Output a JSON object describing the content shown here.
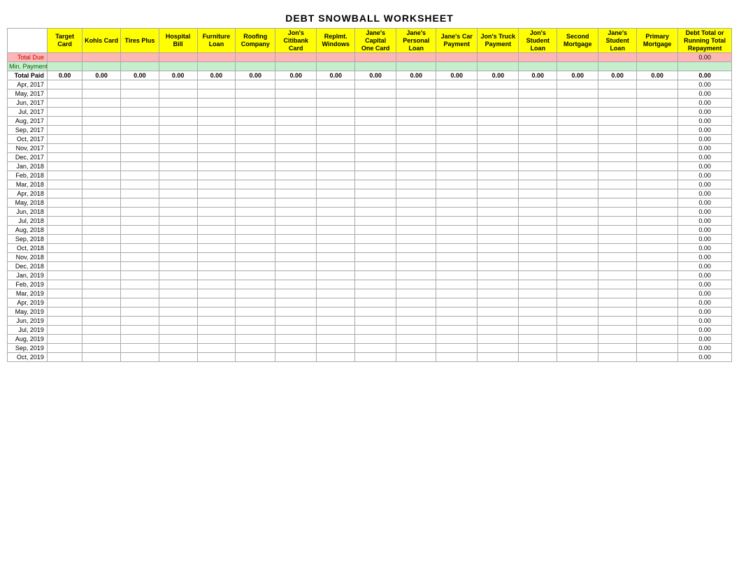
{
  "title": "DEBT SNOWBALL WORKSHEET",
  "columns": [
    {
      "id": "date",
      "label": "",
      "sub": "",
      "bg": "white"
    },
    {
      "id": "target",
      "label": "Target",
      "sub": "Card",
      "bg": "yellow"
    },
    {
      "id": "kohls",
      "label": "Kohls Card",
      "sub": "",
      "bg": "yellow"
    },
    {
      "id": "tires",
      "label": "Tires Plus",
      "sub": "",
      "bg": "yellow"
    },
    {
      "id": "hospital",
      "label": "Hospital",
      "sub": "Bill",
      "bg": "yellow"
    },
    {
      "id": "furniture",
      "label": "Furniture",
      "sub": "Loan",
      "bg": "yellow"
    },
    {
      "id": "roofing",
      "label": "Roofing",
      "sub": "Company",
      "bg": "yellow"
    },
    {
      "id": "jons_citibank",
      "label": "Jon's",
      "sub": "Citibank Card",
      "bg": "yellow"
    },
    {
      "id": "replmt_windows",
      "label": "Replmt.",
      "sub": "Windows",
      "bg": "yellow"
    },
    {
      "id": "janes_capital",
      "label": "Jane's",
      "sub": "Capital One Card",
      "bg": "yellow"
    },
    {
      "id": "janes_personal",
      "label": "Jane's",
      "sub": "Personal Loan",
      "bg": "yellow"
    },
    {
      "id": "janes_car",
      "label": "Jane's Car",
      "sub": "Payment",
      "bg": "yellow"
    },
    {
      "id": "jons_truck",
      "label": "Jon's Truck",
      "sub": "Payment",
      "bg": "yellow"
    },
    {
      "id": "jons_student",
      "label": "Jon's",
      "sub": "Student Loan",
      "bg": "yellow"
    },
    {
      "id": "second_mortgage",
      "label": "Second",
      "sub": "Mortgage",
      "bg": "yellow"
    },
    {
      "id": "janes_student",
      "label": "Jane's",
      "sub": "Student Loan",
      "bg": "yellow"
    },
    {
      "id": "primary_mortgage",
      "label": "Primary",
      "sub": "Mortgage",
      "bg": "yellow"
    },
    {
      "id": "debt_total",
      "label": "Debt Total or",
      "sub": "Running Total Repayment",
      "bg": "yellow"
    }
  ],
  "special_rows": {
    "total_due_label": "Total Due",
    "min_payment_label": "Min. Payment",
    "total_paid_label": "Total Paid"
  },
  "total_paid_values": [
    "0.00",
    "0.00",
    "0.00",
    "0.00",
    "0.00",
    "0.00",
    "0.00",
    "0.00",
    "0.00",
    "0.00",
    "0.00",
    "0.00",
    "0.00",
    "0.00",
    "0.00",
    "0.00",
    "0.00"
  ],
  "last_col_value": "0.00",
  "months": [
    "Apr, 2017",
    "May, 2017",
    "Jun, 2017",
    "Jul, 2017",
    "Aug, 2017",
    "Sep, 2017",
    "Oct, 2017",
    "Nov, 2017",
    "Dec, 2017",
    "Jan, 2018",
    "Feb, 2018",
    "Mar, 2018",
    "Apr, 2018",
    "May, 2018",
    "Jun, 2018",
    "Jul, 2018",
    "Aug, 2018",
    "Sep, 2018",
    "Oct, 2018",
    "Nov, 2018",
    "Dec, 2018",
    "Jan, 2019",
    "Feb, 2019",
    "Mar, 2019",
    "Apr, 2019",
    "May, 2019",
    "Jun, 2019",
    "Jul, 2019",
    "Aug, 2019",
    "Sep, 2019",
    "Oct, 2019"
  ]
}
